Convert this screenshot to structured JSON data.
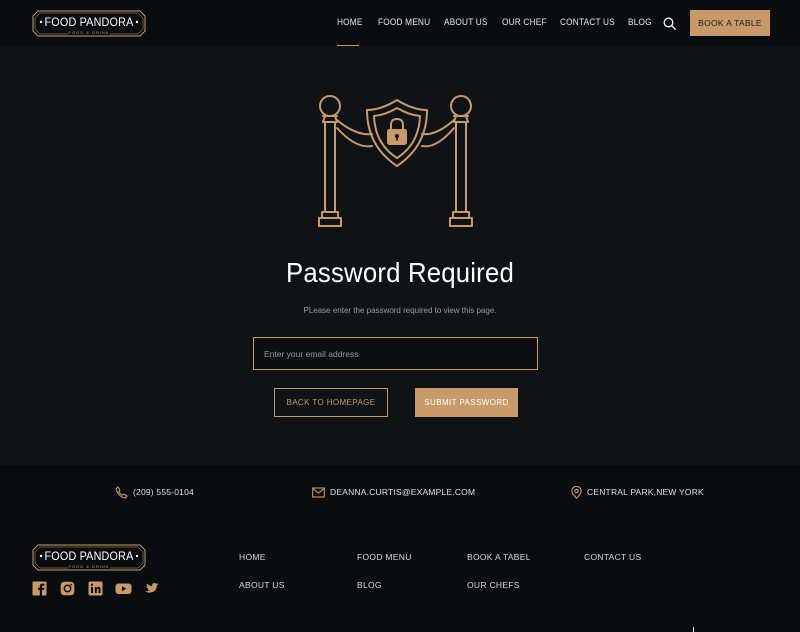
{
  "brand": {
    "name": "FOOD PANDORA",
    "tagline": "FOOD & DRINK",
    "accent": "#c89a6a"
  },
  "nav": {
    "items": [
      "HOME",
      "FOOD MENU",
      "ABOUT US",
      "OUR CHEF",
      "CONTACT US",
      "BLOG"
    ],
    "active": "HOME",
    "search_icon": "search-icon",
    "cta": "BOOK A TABLE"
  },
  "main": {
    "icon": "password-protected-rope-barrier-icon",
    "title": "Password Required",
    "subtitle": "PLease enter the password required to view this page.",
    "input_placeholder": "Enter your email address",
    "back_button": "BACK TO HOMEPAGE",
    "submit_button": "SUBMIT PASSWORD"
  },
  "footer": {
    "contact": {
      "phone": "(209) 555-0104",
      "email": "DEANNA.CURTIS@EXAMPLE.COM",
      "address": "CENTRAL PARK,NEW YORK"
    },
    "social": [
      "facebook-icon",
      "instagram-icon",
      "linkedin-icon",
      "youtube-icon",
      "twitter-icon"
    ],
    "links": {
      "col1": [
        "HOME",
        "ABOUT US"
      ],
      "col2": [
        "FOOD MENU",
        "BLOG"
      ],
      "col3": [
        "BOOK A TABEL",
        "OUR CHEFS"
      ],
      "col4": [
        "CONTACT US"
      ]
    }
  }
}
